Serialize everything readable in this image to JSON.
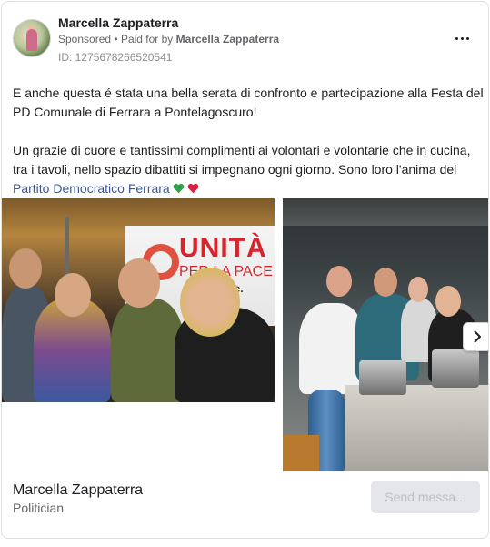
{
  "header": {
    "page_name": "Marcella Zappaterra",
    "sponsored_label": "Sponsored",
    "separator": "•",
    "paid_for_prefix": "Paid for by",
    "paid_for_name": "Marcella Zappaterra",
    "ad_id": "ID: 1275678266520541",
    "more_icon": "more-horizontal-icon"
  },
  "post": {
    "paragraph_1": "E anche questa é stata una bella serata di confronto e partecipazione alla Festa del PD Comunale di Ferrara a Pontelagoscuro!",
    "paragraph_2_text": "Un grazie di cuore e tantissimi complimenti ai volontari e volontarie che in cucina, tra i tavoli, nello spazio dibattiti si impegnano ogni giorno. Sono loro l'anima del ",
    "paragraph_2_link": "Partito Democratico Ferrara",
    "emojis": [
      "green-heart-icon",
      "red-heart-icon"
    ],
    "colors": {
      "green_heart": "#31a24c",
      "red_heart": "#e41e3f",
      "link": "#385898"
    }
  },
  "carousel": {
    "slide_1": {
      "banner_line_1": "UNITÀ",
      "banner_line_2": "PER LA PACE",
      "banner_line_3": "le idee."
    },
    "next_icon": "chevron-right-icon"
  },
  "footer": {
    "page_name": "Marcella Zappaterra",
    "category": "Politician",
    "cta_label": "Send messa..."
  }
}
